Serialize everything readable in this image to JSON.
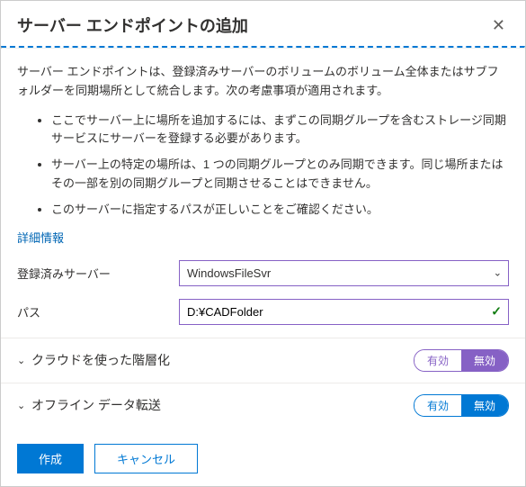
{
  "header": {
    "title": "サーバー エンドポイントの追加"
  },
  "description": "サーバー エンドポイントは、登録済みサーバーのボリュームのボリューム全体またはサブフォルダーを同期場所として統合します。次の考慮事項が適用されます。",
  "bullets": [
    "ここでサーバー上に場所を追加するには、まずこの同期グループを含むストレージ同期サービスにサーバーを登録する必要があります。",
    "サーバー上の特定の場所は、1 つの同期グループとのみ同期できます。同じ場所またはその一部を別の同期グループと同期させることはできません。",
    "このサーバーに指定するパスが正しいことをご確認ください。"
  ],
  "more_info": "詳細情報",
  "form": {
    "server_label": "登録済みサーバー",
    "server_value": "WindowsFileSvr",
    "path_label": "パス",
    "path_value": "D:¥CADFolder"
  },
  "sections": {
    "tiering_label": "クラウドを使った階層化",
    "offline_label": "オフライン データ転送",
    "on": "有効",
    "off": "無効"
  },
  "footer": {
    "create": "作成",
    "cancel": "キャンセル"
  }
}
